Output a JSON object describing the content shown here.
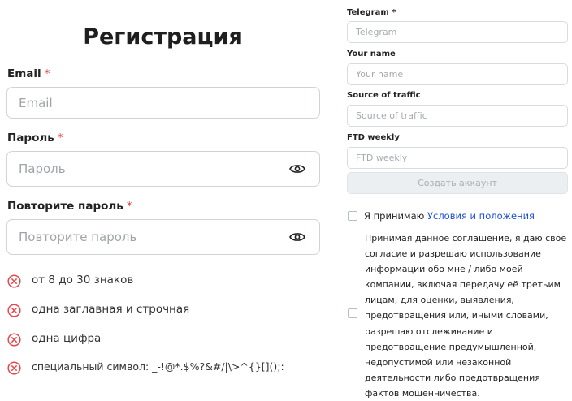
{
  "title": "Регистрация",
  "email": {
    "label": "Email",
    "required_mark": "*",
    "placeholder": "Email"
  },
  "password": {
    "label": "Пароль",
    "required_mark": "*",
    "placeholder": "Пароль",
    "toggle_icon": "eye-icon"
  },
  "confirm_password": {
    "label": "Повторите пароль",
    "required_mark": "*",
    "placeholder": "Повторите пароль",
    "toggle_icon": "eye-icon"
  },
  "password_rules": [
    {
      "text": "от 8 до 30 знаков",
      "status": "invalid",
      "icon": "x-circle-icon"
    },
    {
      "text": "одна заглавная и строчная",
      "status": "invalid",
      "icon": "x-circle-icon"
    },
    {
      "text": "одна цифра",
      "status": "invalid",
      "icon": "x-circle-icon"
    },
    {
      "text": "специальный символ: _-!@*.$%?&#/|\\>^{}[]();:",
      "status": "invalid",
      "icon": "x-circle-icon"
    }
  ],
  "telegram": {
    "label": "Telegram",
    "required_mark": "*",
    "placeholder": "Telegram"
  },
  "your_name": {
    "label": "Your name",
    "placeholder": "Your name"
  },
  "source_of_traffic": {
    "label": "Source of traffic",
    "placeholder": "Source of traffic"
  },
  "ftd_weekly": {
    "label": "FTD weekly",
    "placeholder": "FTD weekly"
  },
  "submit_label": "Создать аккаунт",
  "terms": {
    "prefix": "Я принимаю ",
    "link": "Условия и положения"
  },
  "consent_text": "Принимая данное соглашение, я даю свое согласие и разрешаю использование информации обо мне / либо моей компании, включая передачу её третьим лицам, для оценки, выявления, предотвращения или, иными словами, разрешаю отслеживание и предотвращение предумышленной, недопустимой или незаконной деятельности либо предотвращения фактов мошенничества.",
  "colors": {
    "required": "#e03a3a",
    "error_icon": "#e5484d",
    "link": "#1f4fd6",
    "disabled_button": "#eceff1"
  }
}
